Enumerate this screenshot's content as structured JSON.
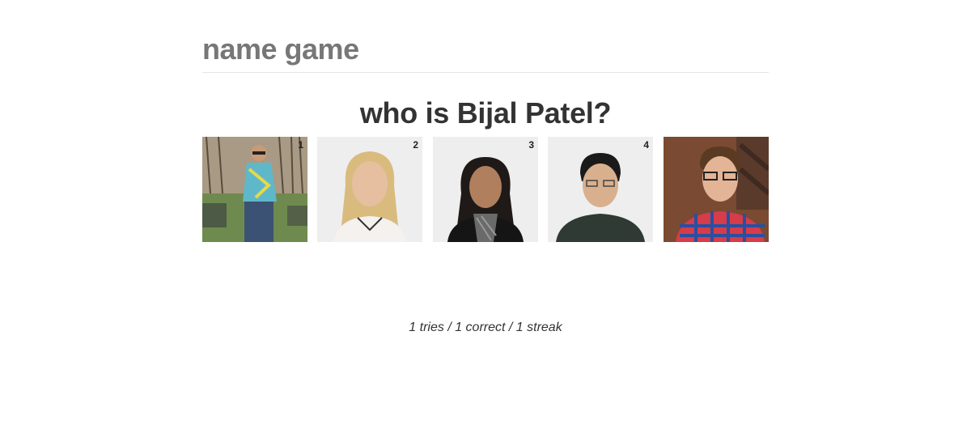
{
  "header": {
    "title": "name game"
  },
  "question": {
    "text": "who is Bijal Patel?"
  },
  "photos": [
    {
      "number": "1",
      "description": "man-in-park-photo"
    },
    {
      "number": "2",
      "description": "woman-blonde-photo"
    },
    {
      "number": "3",
      "description": "woman-scarf-photo"
    },
    {
      "number": "4",
      "description": "man-glasses-photo"
    },
    {
      "number": "",
      "description": "man-plaid-shirt-photo"
    }
  ],
  "score": {
    "text": "1 tries / 1 correct / 1 streak"
  }
}
